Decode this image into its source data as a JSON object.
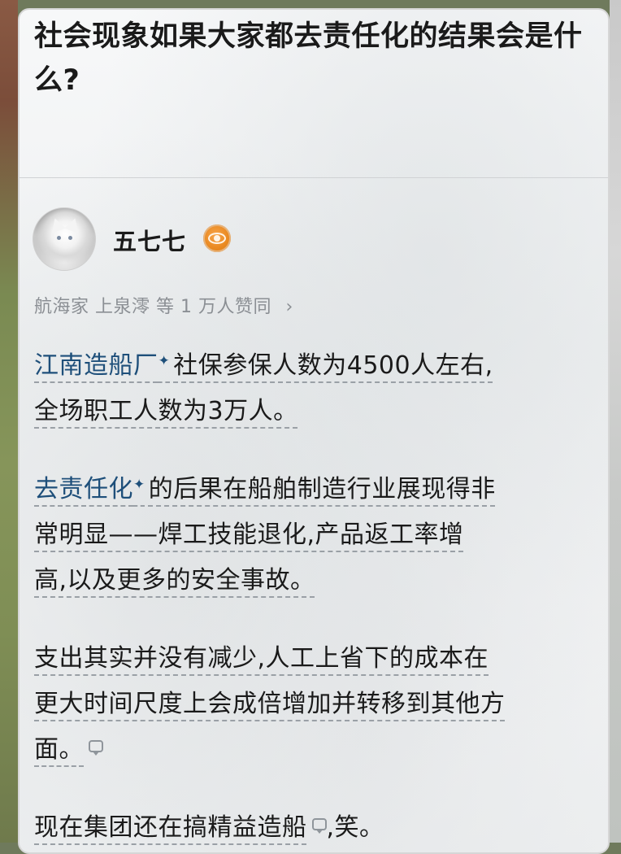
{
  "question": {
    "title": "社会现象如果大家都去责任化的结果会是什么?"
  },
  "answer": {
    "author": {
      "name": "五七七",
      "badge_icon": "eye-badge-icon"
    },
    "upvoters_text": "航海家 上泉澪 等 1 万人赞同",
    "upvoters_chevron": "›",
    "paragraphs": {
      "p1": {
        "link": "江南造船厂",
        "spark": "✦",
        "line1": "社保参保人数为4500人左右,",
        "line2": "全场职工人数为3万人。"
      },
      "p2": {
        "link": "去责任化",
        "spark": "✦",
        "line1": "的后果在船舶制造行业展现得非",
        "line2": "常明显——焊工技能退化,产品返工率增",
        "line3": "高,以及更多的安全事故。"
      },
      "p3": {
        "line1": "支出其实并没有减少,人工上省下的成本在",
        "line2": "更大时间尺度上会成倍增加并转移到其他方",
        "line3": "面。"
      },
      "p4": {
        "line1a": "现在集团还在搞精益造船",
        "line1b": ",笑。"
      }
    }
  }
}
